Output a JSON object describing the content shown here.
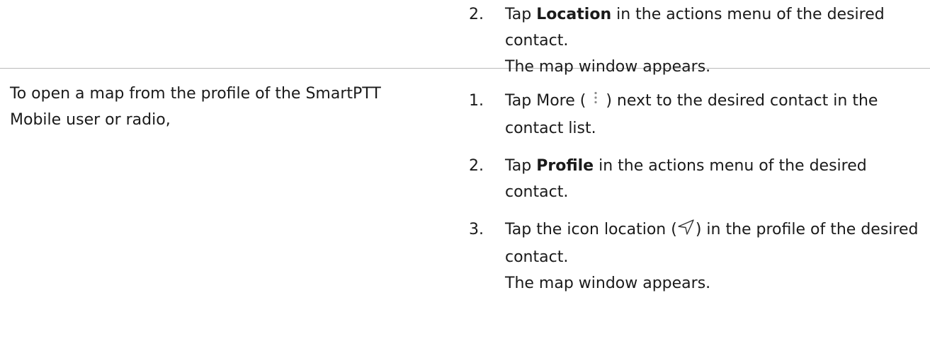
{
  "row1": {
    "steps": [
      {
        "number": "2.",
        "pre": "Tap ",
        "bold": "Location",
        "post": " in the actions menu of the desired contact.",
        "result": "The map window appears."
      }
    ]
  },
  "row2": {
    "condition": "To open a map from the profile of the SmartPTT Mobile user or radio,",
    "step1": {
      "number": "1.",
      "pre": "Tap More (",
      "icon": "more-vertical-icon",
      "post": ") next to the desired contact in the contact list."
    },
    "step2": {
      "number": "2.",
      "pre": "Tap ",
      "bold": "Profile",
      "post": " in the actions menu of the desired contact."
    },
    "step3": {
      "number": "3.",
      "pre": "Tap the icon location (",
      "icon": "location-arrow-icon",
      "post": ") in the profile of the desired contact.",
      "result": "The map window appears."
    }
  }
}
